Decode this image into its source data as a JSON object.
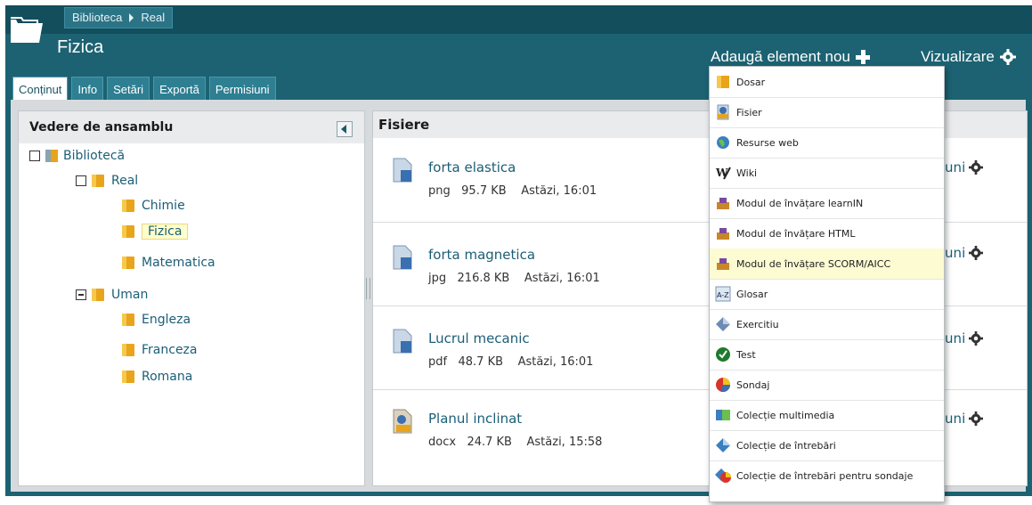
{
  "breadcrumb": [
    "Biblioteca",
    "Real"
  ],
  "title": "Fizica",
  "tabs": [
    "Conținut",
    "Info",
    "Setări",
    "Exportă",
    "Permisiuni"
  ],
  "header_actions": {
    "add": "Adaugă element nou",
    "view": "Vizualizare"
  },
  "tree": {
    "title": "Vedere de ansamblu",
    "root": "Bibliotecă",
    "real": "Real",
    "chimie": "Chimie",
    "fizica": "Fizica",
    "matematica": "Matematica",
    "uman": "Uman",
    "engleza": "Engleza",
    "franceza": "Franceza",
    "romana": "Romana"
  },
  "files": {
    "title": "Fisiere",
    "action_label": "țiuni",
    "items": [
      {
        "name": "forta elastica",
        "type": "png",
        "size": "95.7 KB",
        "date": "Astăzi, 16:01"
      },
      {
        "name": "forta magnetica",
        "type": "jpg",
        "size": "216.8 KB",
        "date": "Astăzi, 16:01"
      },
      {
        "name": "Lucrul mecanic",
        "type": "pdf",
        "size": "48.7 KB",
        "date": "Astăzi, 16:01"
      },
      {
        "name": "Planul inclinat",
        "type": "docx",
        "size": "24.7 KB",
        "date": "Astăzi, 15:58"
      }
    ]
  },
  "menu": [
    {
      "label": "Dosar",
      "icon": "folder-icon"
    },
    {
      "label": "Fisier",
      "icon": "file-icon"
    },
    {
      "label": "Resurse web",
      "icon": "globe-icon"
    },
    {
      "label": "Wiki",
      "icon": "wiki-icon"
    },
    {
      "label": "Modul de învățare learnIN",
      "icon": "module-icon"
    },
    {
      "label": "Modul de învățare HTML",
      "icon": "module-icon"
    },
    {
      "label": "Modul de învățare SCORM/AICC",
      "icon": "module-icon"
    },
    {
      "label": "Glosar",
      "icon": "glossary-icon"
    },
    {
      "label": "Exercitiu",
      "icon": "exercise-icon"
    },
    {
      "label": "Test",
      "icon": "check-icon"
    },
    {
      "label": "Sondaj",
      "icon": "poll-icon"
    },
    {
      "label": "Colecție multimedia",
      "icon": "multimedia-icon"
    },
    {
      "label": "Colecție de întrebări",
      "icon": "question-icon"
    },
    {
      "label": "Colecție de întrebări pentru sondaje",
      "icon": "poll-question-icon"
    }
  ],
  "colors": {
    "header": "#1c6272",
    "link": "#1b5e76",
    "highlight": "#ffffcc"
  }
}
